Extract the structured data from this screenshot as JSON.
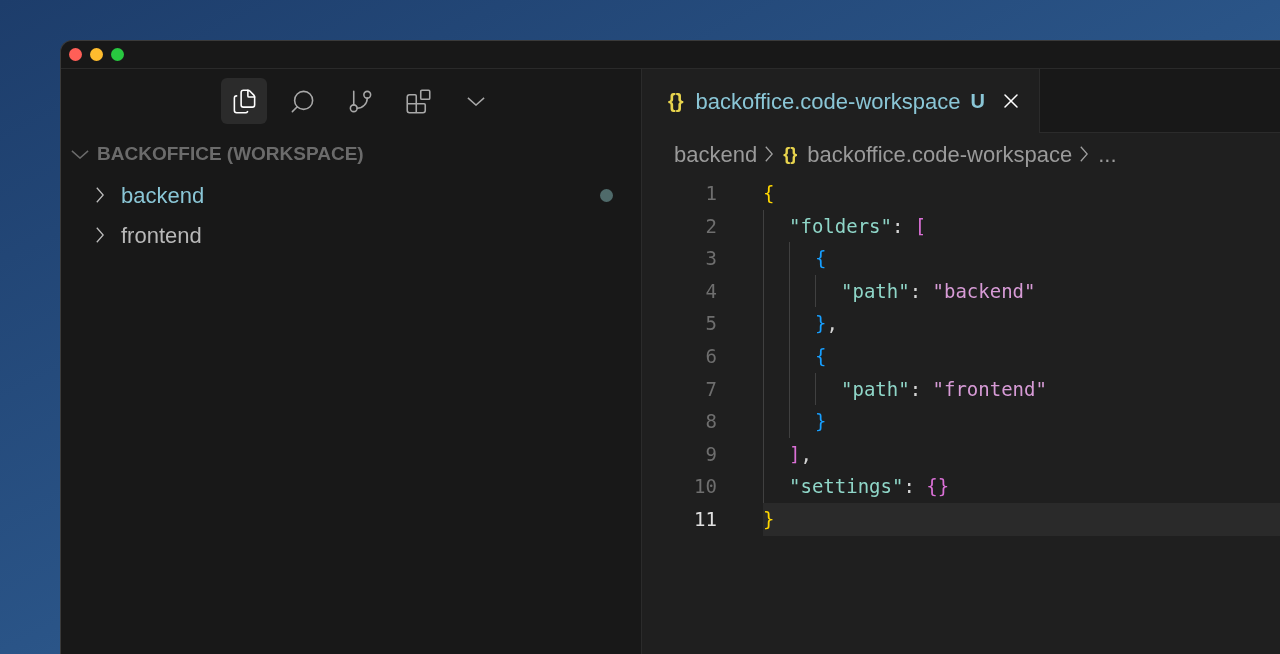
{
  "window": {
    "traffic_lights": [
      {
        "color": "#ff5f57"
      },
      {
        "color": "#febc2e"
      },
      {
        "color": "#28c840"
      }
    ]
  },
  "activity_bar": {
    "items": [
      {
        "kind": "explorer",
        "selected": true
      },
      {
        "kind": "search",
        "selected": false
      },
      {
        "kind": "source-control",
        "selected": false
      },
      {
        "kind": "extensions",
        "selected": false
      },
      {
        "kind": "more",
        "selected": false
      }
    ]
  },
  "sidebar": {
    "section": {
      "title": "BACKOFFICE (WORKSPACE)",
      "expanded": true
    },
    "items": [
      {
        "label": "backend",
        "expanded": false,
        "modified": true
      },
      {
        "label": "frontend",
        "expanded": false,
        "modified": false
      }
    ]
  },
  "tab": {
    "icon": "{}",
    "label": "backoffice.code-workspace",
    "badge": "U",
    "selected": true
  },
  "breadcrumb": [
    {
      "label": "backend"
    },
    {
      "icon": "{}",
      "label": "backoffice.code-workspace"
    },
    {
      "label": "..."
    }
  ],
  "editor": {
    "lines": [
      {
        "number": "1",
        "current": false,
        "tokens": [
          {
            "kind": "brace",
            "text": "{"
          }
        ],
        "children": [
          {
            "number": "2",
            "current": false,
            "tokens": [
              {
                "kind": "key",
                "text": "\"folders\""
              },
              {
                "kind": "plain",
                "text": ": "
              },
              {
                "kind": "bracket",
                "text": "["
              }
            ],
            "children": [
              {
                "number": "3",
                "current": false,
                "tokens": [
                  {
                    "kind": "brace2",
                    "text": "{"
                  }
                ],
                "children": [
                  {
                    "number": "4",
                    "current": false,
                    "tokens": [
                      {
                        "kind": "key",
                        "text": "\"path\""
                      },
                      {
                        "kind": "plain",
                        "text": ": "
                      },
                      {
                        "kind": "string",
                        "text": "\"backend\""
                      }
                    ]
                  }
                ]
              },
              {
                "number": "5",
                "current": false,
                "tokens": [
                  {
                    "kind": "brace2",
                    "text": "}"
                  },
                  {
                    "kind": "plain",
                    "text": ","
                  }
                ]
              },
              {
                "number": "6",
                "current": false,
                "tokens": [
                  {
                    "kind": "brace2",
                    "text": "{"
                  }
                ],
                "children": [
                  {
                    "number": "7",
                    "current": false,
                    "tokens": [
                      {
                        "kind": "key",
                        "text": "\"path\""
                      },
                      {
                        "kind": "plain",
                        "text": ": "
                      },
                      {
                        "kind": "string",
                        "text": "\"frontend\""
                      }
                    ]
                  }
                ]
              },
              {
                "number": "8",
                "current": false,
                "tokens": [
                  {
                    "kind": "brace2",
                    "text": "}"
                  }
                ]
              }
            ]
          },
          {
            "number": "9",
            "current": false,
            "tokens": [
              {
                "kind": "bracket",
                "text": "]"
              },
              {
                "kind": "plain",
                "text": ","
              }
            ]
          },
          {
            "number": "10",
            "current": false,
            "tokens": [
              {
                "kind": "key",
                "text": "\"settings\""
              },
              {
                "kind": "plain",
                "text": ": "
              },
              {
                "kind": "bracket",
                "text": "{}"
              }
            ]
          }
        ]
      },
      {
        "number": "11",
        "current": true,
        "tokens": [
          {
            "kind": "brace",
            "text": "}"
          }
        ]
      }
    ]
  }
}
